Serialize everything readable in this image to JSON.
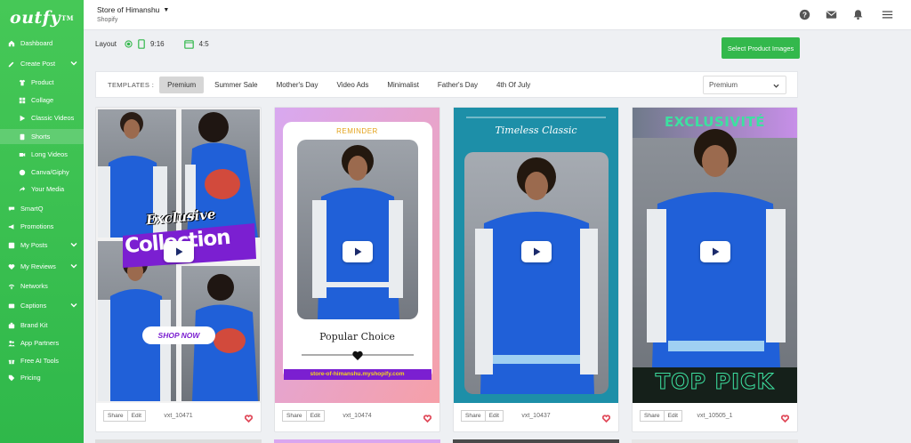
{
  "app": {
    "logo_text": "outfy",
    "logo_tm": "TM",
    "store_name": "Store of Himanshu",
    "store_platform": "Shopify"
  },
  "sidebar": {
    "items": [
      {
        "label": "Dashboard",
        "icon": "home-icon"
      },
      {
        "label": "Create Post",
        "icon": "pencil-icon",
        "chevron": true
      },
      {
        "label": "Product",
        "icon": "shirt-icon",
        "sub": true
      },
      {
        "label": "Collage",
        "icon": "grid-icon",
        "sub": true
      },
      {
        "label": "Classic Videos",
        "icon": "play-icon",
        "sub": true
      },
      {
        "label": "Shorts",
        "icon": "shorts-icon",
        "sub": true,
        "active": true
      },
      {
        "label": "Long Videos",
        "icon": "video-icon",
        "sub": true
      },
      {
        "label": "Canva/Giphy",
        "icon": "canva-icon",
        "sub": true
      },
      {
        "label": "Your Media",
        "icon": "share-icon",
        "sub": true
      },
      {
        "label": "SmartQ",
        "icon": "smartq-icon"
      },
      {
        "label": "Promotions",
        "icon": "megaphone-icon"
      },
      {
        "label": "My Posts",
        "icon": "posts-icon",
        "chevron": true
      },
      {
        "label": "My Reviews",
        "icon": "heart-icon",
        "chevron": true
      },
      {
        "label": "Networks",
        "icon": "wifi-icon"
      },
      {
        "label": "Captions",
        "icon": "caption-icon",
        "chevron": true
      },
      {
        "label": "Brand Kit",
        "icon": "brand-icon"
      },
      {
        "label": "App Partners",
        "icon": "users-icon"
      },
      {
        "label": "Free AI Tools",
        "icon": "gift-icon"
      },
      {
        "label": "Pricing",
        "icon": "tag-icon"
      }
    ]
  },
  "layout": {
    "label": "Layout",
    "options": [
      {
        "label": "9:16",
        "selected": true
      },
      {
        "label": "4:5",
        "selected": false
      }
    ],
    "select_button": "Select Product Images"
  },
  "templates": {
    "label": "TEMPLATES :",
    "tabs": [
      "Premium",
      "Summer Sale",
      "Mother's Day",
      "Video Ads",
      "Minimalist",
      "Father's Day",
      "4th Of July"
    ],
    "active_tab": "Premium",
    "dropdown_value": "Premium"
  },
  "cards": [
    {
      "id": "vxt_10471",
      "texts": {
        "line1": "Exclusive",
        "line2": "Collection",
        "button": "SHOP NOW"
      }
    },
    {
      "id": "vxt_10474",
      "texts": {
        "top": "REMINDER",
        "caption": "Popular Choice",
        "url": "store-of-himanshu.myshopify.com"
      }
    },
    {
      "id": "vxt_10437",
      "texts": {
        "title": "Timeless Classic"
      }
    },
    {
      "id": "vxt_10505_1",
      "texts": {
        "top": "EXCLUSIVITÉ",
        "bottom": "TOP PICK"
      }
    }
  ],
  "card_actions": {
    "share": "Share",
    "edit": "Edit"
  },
  "colors": {
    "brand_green": "#33b84c",
    "jacket_blue": "#1f5ad6",
    "heart_red": "#e04a5a",
    "teal": "#1d8fa8",
    "purple": "#8a2be2"
  }
}
